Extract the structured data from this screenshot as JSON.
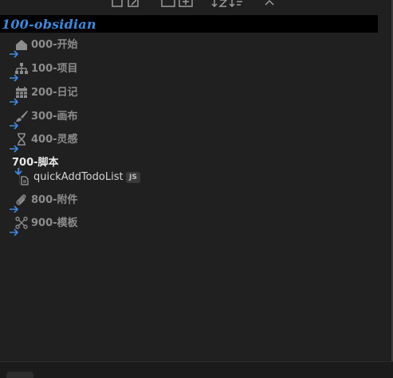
{
  "toolbar": {
    "buttons": [
      {
        "name": "new-note-icon"
      },
      {
        "name": "new-folder-icon"
      },
      {
        "name": "sort-icon"
      },
      {
        "name": "collapse-all-icon"
      }
    ]
  },
  "vault": {
    "title": "100-obsidian",
    "color": "#3f88de"
  },
  "tree": {
    "folders": [
      {
        "label": "000-开始",
        "icon": "home-icon"
      },
      {
        "label": "100-项目",
        "icon": "sitemap-icon"
      },
      {
        "label": "200-日记",
        "icon": "calendar-icon"
      },
      {
        "label": "300-画布",
        "icon": "paintbrush-icon"
      },
      {
        "label": "400-灵感",
        "icon": "hourglass-icon"
      },
      {
        "label": "700-脚本",
        "icon": "none",
        "expanded": true
      },
      {
        "label": "800-附件",
        "icon": "paperclip-icon"
      },
      {
        "label": "900-模板",
        "icon": "template-icon"
      }
    ],
    "files": [
      {
        "name": "quickAddTodoList",
        "ext": "JS"
      }
    ]
  },
  "colors": {
    "background": "#202020",
    "arrow_accent": "#3f88de",
    "folder_text": "#8c8c8c",
    "active_text": "#e6e6e6"
  }
}
